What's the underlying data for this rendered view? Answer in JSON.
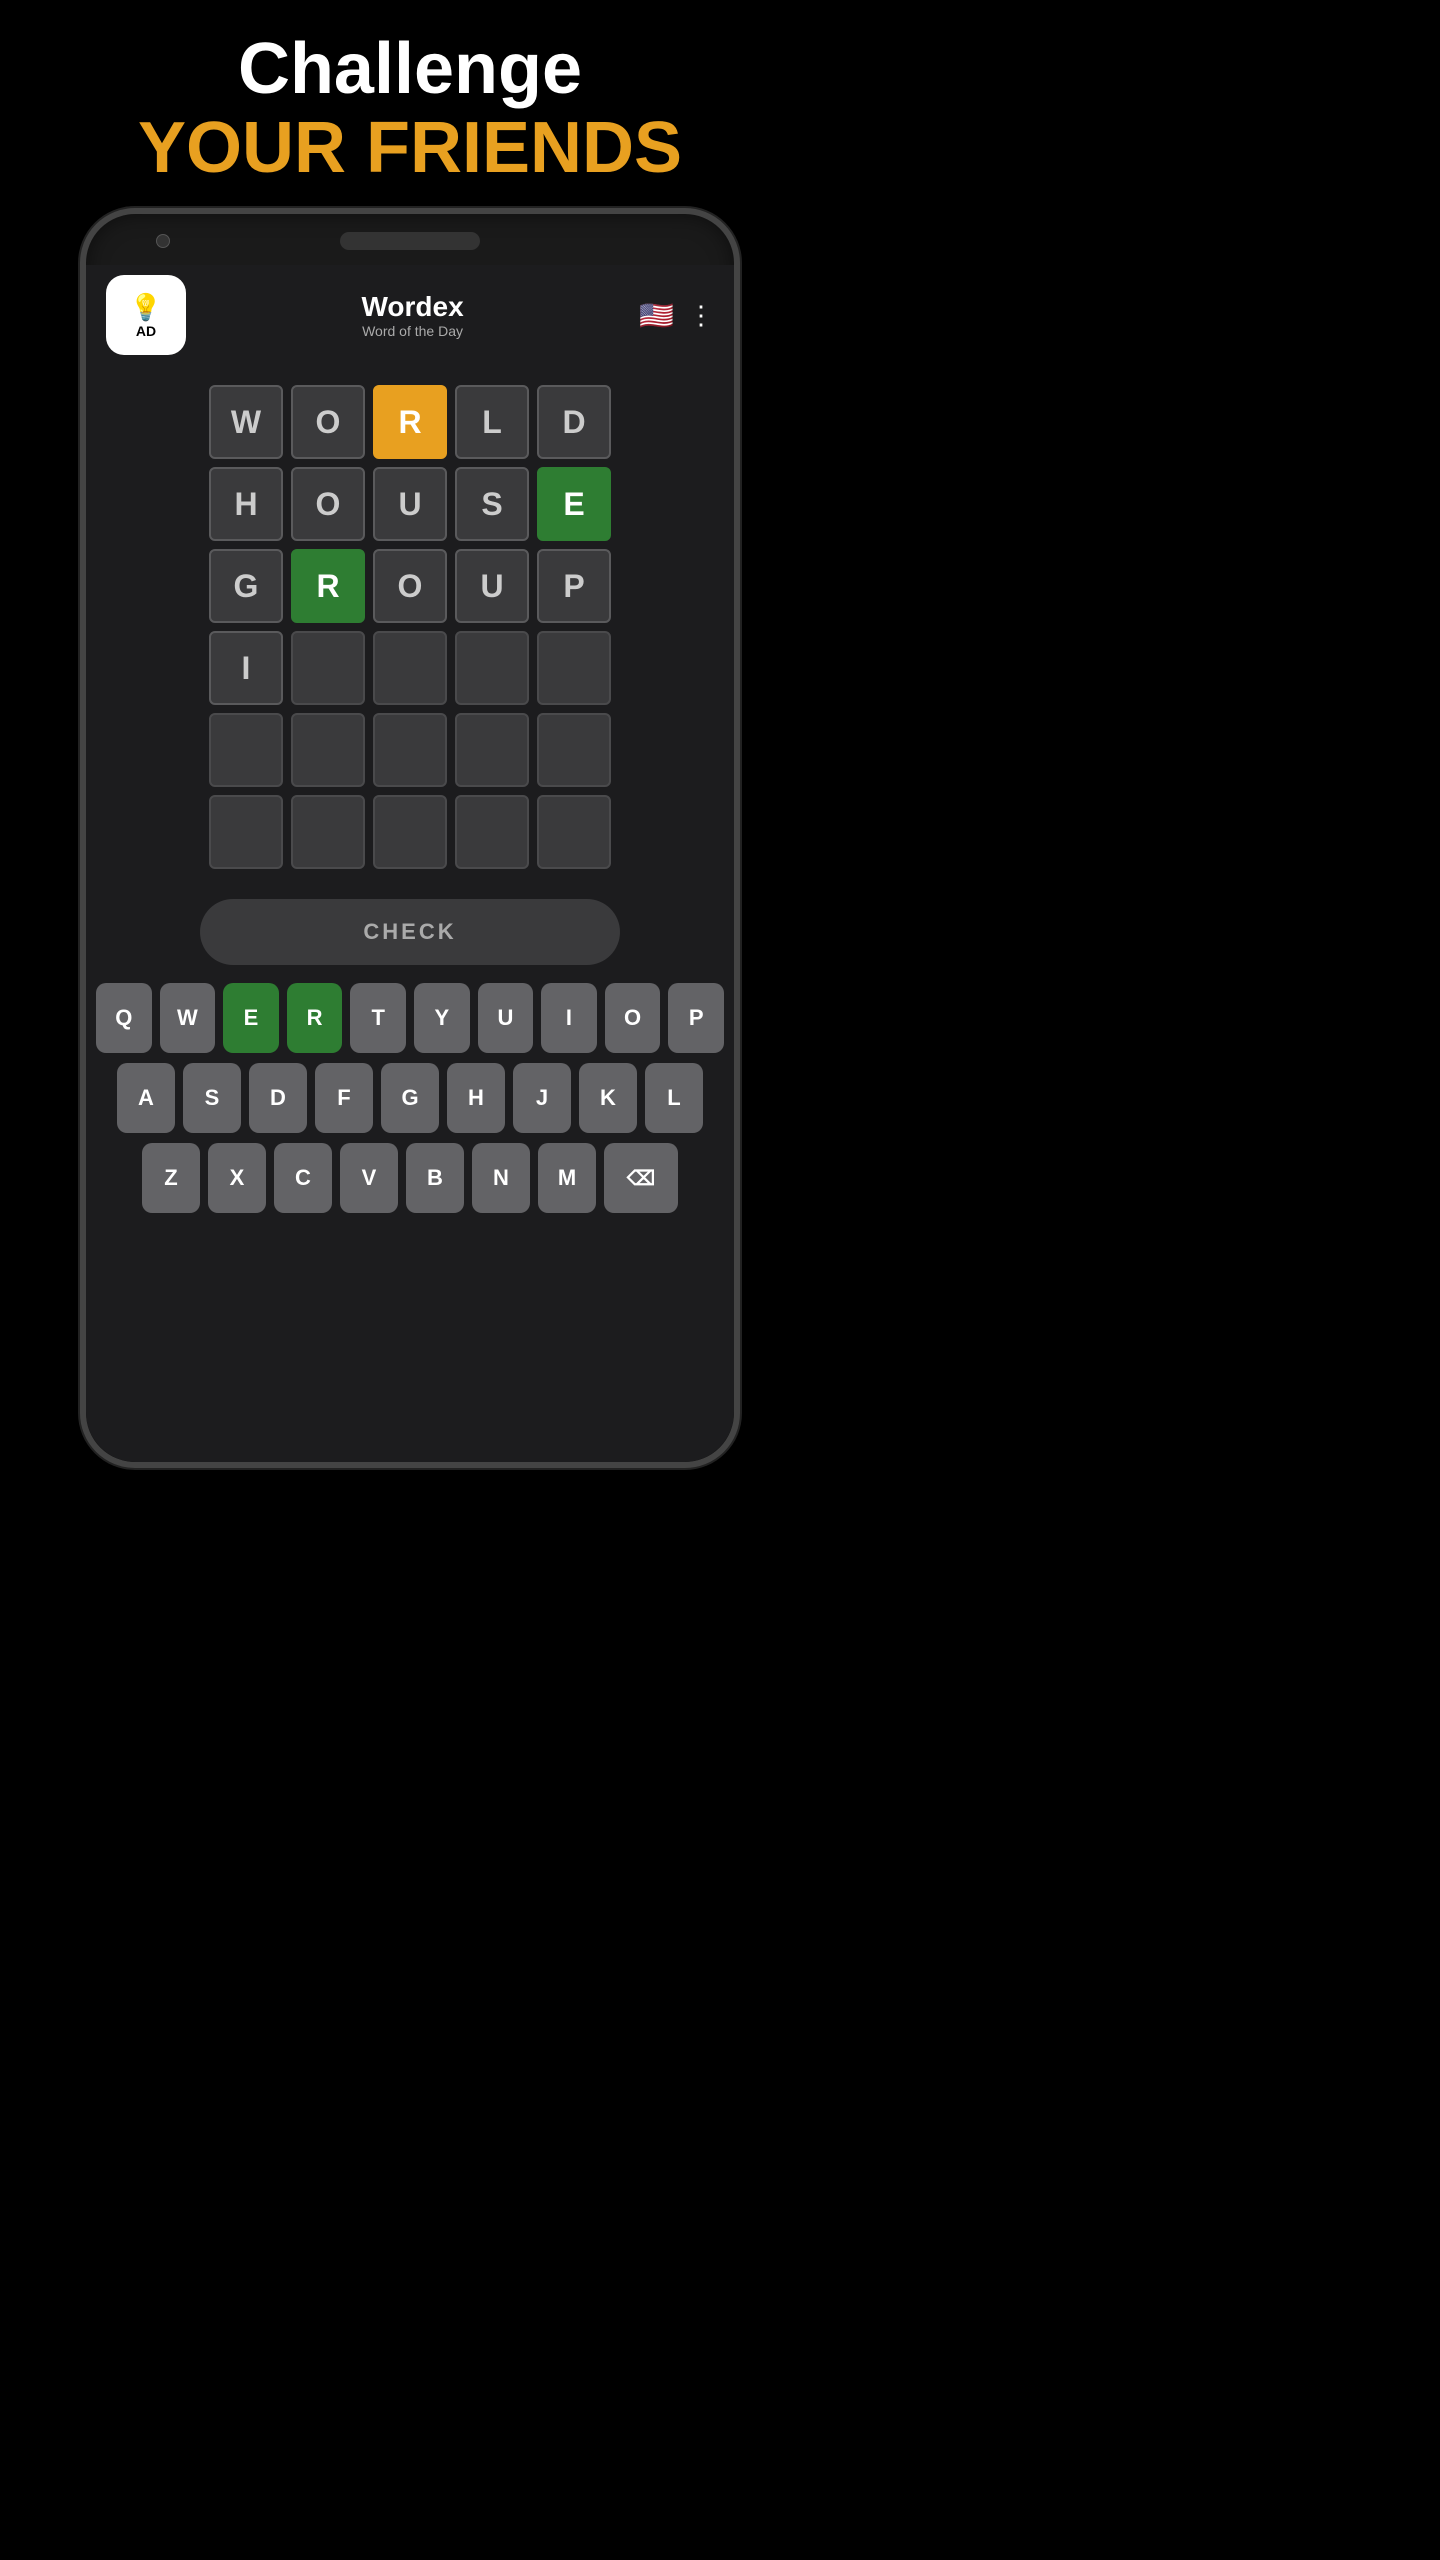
{
  "header": {
    "challenge_text": "Challenge",
    "your_friends_text": "YOUR FRIENDS"
  },
  "app": {
    "ad_label": "AD",
    "bulb_icon": "💡",
    "title": "Wordex",
    "subtitle": "Word of the Day",
    "flag_icon": "🇺🇸",
    "menu_icon": "⋮"
  },
  "grid": {
    "rows": [
      [
        "W",
        "O",
        "R",
        "L",
        "D"
      ],
      [
        "H",
        "O",
        "U",
        "S",
        "E"
      ],
      [
        "G",
        "R",
        "O",
        "U",
        "P"
      ],
      [
        "I",
        "",
        "",
        "",
        ""
      ],
      [
        "",
        "",
        "",
        "",
        ""
      ],
      [
        "",
        "",
        "",
        "",
        ""
      ]
    ],
    "cell_styles": [
      [
        "letter-only",
        "letter-only",
        "orange",
        "letter-only",
        "letter-only"
      ],
      [
        "letter-only",
        "letter-only",
        "letter-only",
        "letter-only",
        "green"
      ],
      [
        "letter-only",
        "green",
        "letter-only",
        "letter-only",
        "letter-only"
      ],
      [
        "letter-only",
        "empty",
        "empty",
        "empty",
        "empty"
      ],
      [
        "empty",
        "empty",
        "empty",
        "empty",
        "empty"
      ],
      [
        "empty",
        "empty",
        "empty",
        "empty",
        "empty"
      ]
    ]
  },
  "check_button": {
    "label": "CHECK"
  },
  "keyboard": {
    "row1": [
      "Q",
      "W",
      "E",
      "R",
      "T",
      "Y",
      "U",
      "I",
      "O",
      "P"
    ],
    "row1_styles": [
      "normal",
      "normal",
      "green",
      "green",
      "normal",
      "normal",
      "normal",
      "normal",
      "normal",
      "normal"
    ],
    "row2": [
      "A",
      "S",
      "D",
      "F",
      "G",
      "H",
      "J",
      "K",
      "L"
    ],
    "row2_styles": [
      "normal",
      "normal",
      "normal",
      "normal",
      "normal",
      "normal",
      "normal",
      "normal",
      "normal"
    ],
    "row3": [
      "Z",
      "X",
      "C",
      "V",
      "B",
      "N",
      "M",
      "⌫"
    ],
    "row3_styles": [
      "normal",
      "normal",
      "normal",
      "normal",
      "normal",
      "normal",
      "normal",
      "backspace"
    ]
  }
}
